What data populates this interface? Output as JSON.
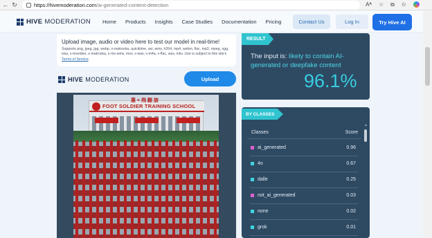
{
  "browser": {
    "url_domain": "https://hivemoderation.com",
    "url_path": "/ai-generated-content-detection",
    "icons": [
      "back-icon",
      "refresh-icon",
      "read-aloud-icon",
      "favorites-icon",
      "collections-icon",
      "copilot-icon"
    ]
  },
  "header": {
    "logo_hive": "HIVE",
    "logo_mod": "MODERATION",
    "nav": [
      "Home",
      "Products",
      "Insights",
      "Case Studies",
      "Documentation",
      "Pricing"
    ],
    "contact": "Contact Us",
    "login": "Log In",
    "try": "Try Hive AI"
  },
  "upload": {
    "title": "Upload image, audio or video here to test our model in real-time!",
    "formats": "Supports png, jpeg, jpg, webp, x-matroska, quicktime, avi, wmv, h264, mp4, webm, flac, mp3, mpeg, ogg, wav, x-msvideo, x-matroska, x-ms-wmv, mov, x-wav, x-m4a, x-flac, wav, mkv. Use is subject to this site's",
    "tos": "Terms of Service",
    "tos_end": ".",
    "logo_hive": "HIVE",
    "logo_mod": "MODERATION",
    "button": "Upload"
  },
  "image": {
    "sign_text": "FOOT SOLDIER TRAINING SCHOOL",
    "sign_glyph": "惠 + 飛 翻 旅"
  },
  "result": {
    "tag": "RESULT",
    "prefix": "The input is: ",
    "verdict": "likely to contain AI-generated or deepfake content",
    "score": "96.1%"
  },
  "classes": {
    "tag": "BY CLASSES",
    "col_class": "Classes",
    "col_score": "Score",
    "rows": [
      {
        "name": "ai_generated",
        "score": "0.96",
        "color": "#e05fd0"
      },
      {
        "name": "4o",
        "score": "0.67",
        "color": "#3fd6e0"
      },
      {
        "name": "dalle",
        "score": "0.25",
        "color": "#3fd6e0"
      },
      {
        "name": "not_ai_generated",
        "score": "0.03",
        "color": "#e05fd0"
      },
      {
        "name": "none",
        "score": "0.02",
        "color": "#3fd6e0"
      },
      {
        "name": "grok",
        "score": "0.01",
        "color": "#3fd6e0"
      }
    ]
  }
}
